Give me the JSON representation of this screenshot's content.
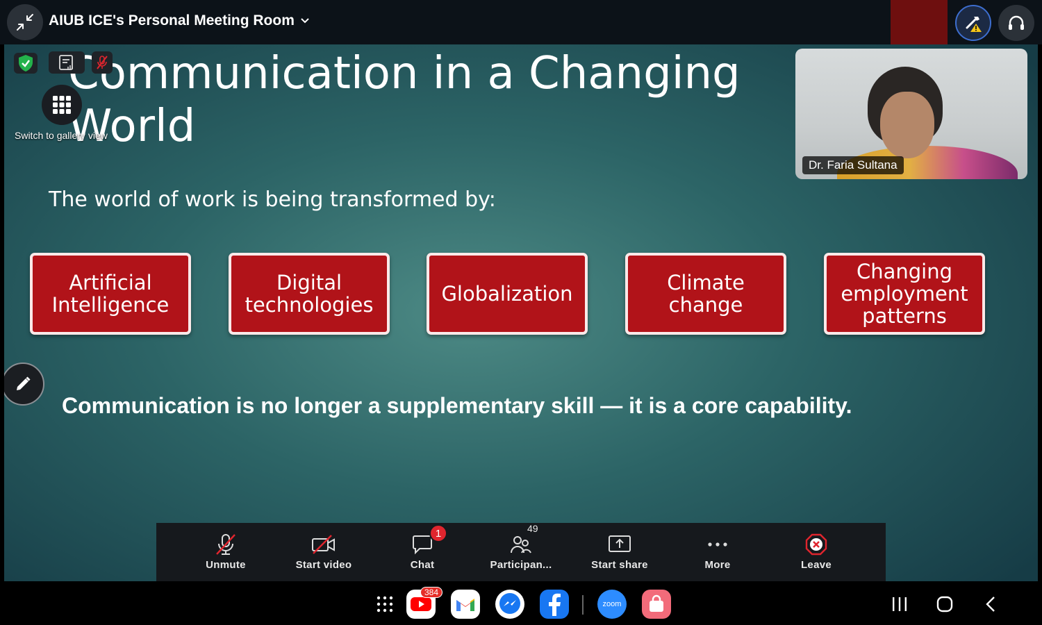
{
  "header": {
    "meeting_title": "AIUB ICE's Personal Meeting Room"
  },
  "slide": {
    "title": "Communication in a Changing World",
    "subtitle": "The world of work is being transformed by:",
    "topics": [
      "Artificial Intelligence",
      "Digital technologies",
      "Globalization",
      "Climate change",
      "Changing employment patterns"
    ],
    "statement": "Communication is no longer a supplementary skill — it is a core capability."
  },
  "overlay": {
    "gallery_label": "Switch to gallery view"
  },
  "video": {
    "participant_name": "Dr. Faria Sultana"
  },
  "toolbar": {
    "unmute": "Unmute",
    "start_video": "Start video",
    "chat": "Chat",
    "chat_badge": "1",
    "participants": "Participan...",
    "participants_count": "49",
    "start_share": "Start share",
    "more": "More",
    "leave": "Leave"
  },
  "navbar": {
    "youtube_badge": "384",
    "zoom_label": "zoom"
  },
  "colors": {
    "topic_box": "#b11319",
    "leave_red": "#e0252e",
    "toolbar_bg": "#16191d",
    "slide_teal": "#2c6466"
  }
}
